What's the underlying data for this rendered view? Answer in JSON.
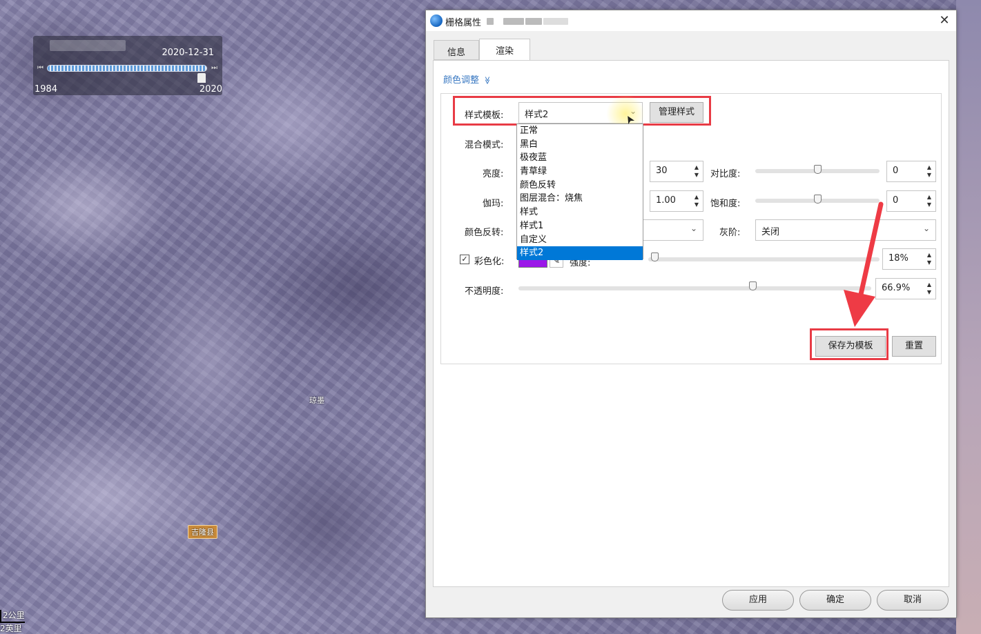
{
  "map": {
    "timeline": {
      "date": "2020-12-31",
      "start_year": "1984",
      "end_year": "2020",
      "progress": 1.0
    },
    "places": [
      {
        "label": "琼墨"
      },
      {
        "label": "吉隆县"
      }
    ],
    "scale": {
      "metric": "2公里",
      "imperial": "2英里"
    }
  },
  "dialog": {
    "title": "栅格属性",
    "close_glyph": "✕",
    "tabs": [
      {
        "label": "信息"
      },
      {
        "label": "渲染"
      }
    ],
    "active_tab": "渲染",
    "section_title": "颜色调整",
    "section_chevron": "≫",
    "style_template": {
      "label": "样式模板:",
      "value": "样式2",
      "manage_button": "管理样式",
      "options": [
        "正常",
        "黑白",
        "极夜蓝",
        "青草绿",
        "颜色反转",
        "图层混合：烧焦",
        "样式",
        "样式1",
        "自定义",
        "样式2"
      ],
      "selected_index": 9
    },
    "blend_mode": {
      "label": "混合模式:"
    },
    "brightness": {
      "label": "亮度:",
      "value": "30"
    },
    "contrast": {
      "label": "对比度:",
      "value": "0",
      "level": 0.5
    },
    "gamma": {
      "label": "伽玛:",
      "value": "1.00"
    },
    "saturation": {
      "label": "饱和度:",
      "value": "0",
      "level": 0.5
    },
    "invert": {
      "label": "颜色反转:"
    },
    "grayscale": {
      "label": "灰阶:",
      "value": "关闭"
    },
    "colorize": {
      "label": "彩色化:",
      "checked": true,
      "color": "#9b17e8",
      "intensity_label": "强度:",
      "intensity_value": "18%",
      "level": 0.0
    },
    "opacity": {
      "label": "不透明度:",
      "value": "66.9%",
      "level": 0.669
    },
    "save_template_button": "保存为模板",
    "reset_button": "重置",
    "footer": {
      "apply": "应用",
      "ok": "确定",
      "cancel": "取消"
    },
    "colors": {
      "accent": "#0078d7",
      "highlight": "#e83b45",
      "link": "#3a79c2"
    }
  }
}
